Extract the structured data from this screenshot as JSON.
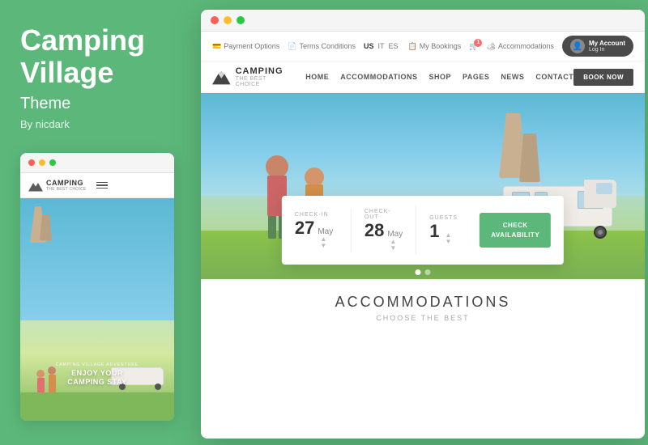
{
  "left": {
    "title": "Camping\nVillage",
    "subtitle": "Theme",
    "author": "By nicdark"
  },
  "mini_browser": {
    "brand_name": "CAMPING",
    "brand_tagline": "THE BEST CHOICE",
    "overlay_small": "CAMPING VILLAGE ADVENTURE",
    "overlay_big": "ENJOY YOUR\nCAMPING STAY"
  },
  "utility_bar": {
    "payment_options": "Payment Options",
    "terms_conditions": "Terms Conditions",
    "lang_us": "US",
    "lang_it": "IT",
    "lang_es": "ES",
    "my_bookings": "My Bookings",
    "accommodations": "Accommodations",
    "my_account": "My Account",
    "log_in": "Log In",
    "cart_count": "1"
  },
  "main_nav": {
    "brand_name": "CAMPING",
    "brand_tagline": "THE BEST CHOICE",
    "home": "HOME",
    "accommodations": "ACCOMMODATIONS",
    "shop": "SHOP",
    "pages": "PAGES",
    "news": "NEWS",
    "contact": "CONTACT",
    "book_now": "BOOK NOW"
  },
  "booking": {
    "checkin_label": "CHECK-IN",
    "checkin_day": "27",
    "checkin_month": "May",
    "checkout_label": "CHECK-OUT",
    "checkout_day": "28",
    "checkout_month": "May",
    "guests_label": "GUESTS",
    "guests_count": "1",
    "check_availability": "CHECK\nAVAILABILITY"
  },
  "accommodations_section": {
    "title": "ACCOMMODATIONS",
    "subtitle": "CHOOSE THE BEST"
  },
  "browser_dots": {
    "colors": [
      "#ff5f57",
      "#ffbd2e",
      "#28ca41"
    ]
  }
}
